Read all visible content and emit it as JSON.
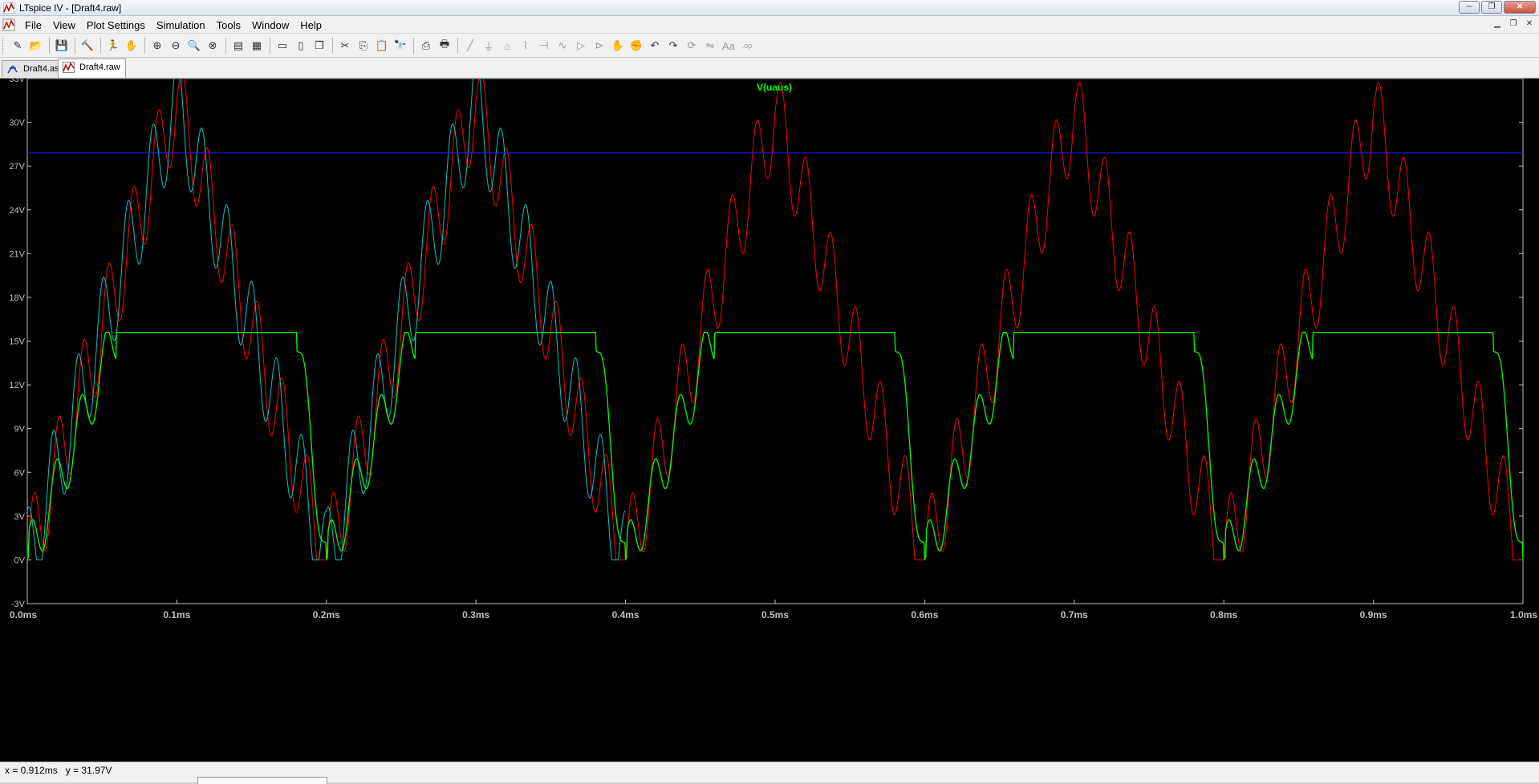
{
  "window": {
    "title": "LTspice IV - [Draft4.raw]",
    "minimize_label": "─",
    "restore_label": "❐",
    "close_label": "✕"
  },
  "menubar": {
    "items": [
      "File",
      "View",
      "Plot Settings",
      "Simulation",
      "Tools",
      "Window",
      "Help"
    ]
  },
  "toolbar": {
    "icons": [
      "new-schematic-icon",
      "open-icon",
      "sep",
      "save-icon",
      "sep",
      "control-panel-icon",
      "sep",
      "run-icon",
      "halt-icon",
      "sep",
      "zoom-in-icon",
      "zoom-out-icon",
      "zoom-area-icon",
      "zoom-fit-icon",
      "sep",
      "autorange-icon",
      "grid-icon",
      "sep",
      "tile-horizontal-icon",
      "tile-vertical-icon",
      "cascade-icon",
      "sep",
      "cut-icon",
      "copy-icon",
      "paste-icon",
      "find-icon",
      "sep",
      "print-preview-icon",
      "print-icon",
      "sep",
      "wire-icon",
      "ground-icon",
      "label-icon",
      "resistor-icon",
      "capacitor-icon",
      "inductor-icon",
      "diode-icon",
      "component-icon",
      "move-icon",
      "drag-icon",
      "undo-icon",
      "redo-icon",
      "rotate-icon",
      "mirror-icon",
      "text-icon",
      "spice-directive-icon"
    ]
  },
  "tabs": [
    {
      "label": "Draft4.asc",
      "active": false
    },
    {
      "label": "Draft4.raw",
      "active": true
    }
  ],
  "status": {
    "cursor_x": "x = 0.912ms",
    "cursor_y": "y = 31.97V"
  },
  "chart_data": {
    "type": "line",
    "title": "V(uaus)",
    "xlabel": "",
    "ylabel": "",
    "xlim": [
      0,
      1.0
    ],
    "ylim": [
      -3,
      33
    ],
    "x_ticks": [
      "0.0ms",
      "0.1ms",
      "0.2ms",
      "0.3ms",
      "0.4ms",
      "0.5ms",
      "0.6ms",
      "0.7ms",
      "0.8ms",
      "0.9ms",
      "1.0ms"
    ],
    "y_ticks": [
      "-3V",
      "0V",
      "3V",
      "6V",
      "9V",
      "12V",
      "15V",
      "18V",
      "21V",
      "24V",
      "27V",
      "30V",
      "33V"
    ],
    "grid": false,
    "colors": {
      "background": "#000000",
      "axes": "#c0c0c0",
      "title": "#00ff00",
      "red_trace": "#ff0000",
      "cyan_trace": "#00c8c8",
      "green_trace": "#00ff00",
      "blue_line": "#1a1aff"
    },
    "series": [
      {
        "name": "V(uaus)",
        "color": "#00ff00",
        "x": [
          0,
          0.02,
          0.06,
          0.18,
          0.2,
          0.22,
          0.26,
          0.38,
          0.4,
          0.42,
          0.46,
          0.58,
          0.6,
          0.62,
          0.66,
          0.78,
          0.8,
          0.82,
          0.86,
          0.98,
          1.0
        ],
        "values": [
          0,
          5,
          15.6,
          15.6,
          0,
          5,
          15.6,
          15.6,
          0,
          5,
          15.6,
          15.6,
          0,
          5,
          15.6,
          15.6,
          0,
          5,
          15.6,
          15.6,
          0
        ]
      },
      {
        "color": "#ff0000",
        "x": [
          0,
          0.1,
          0.2,
          0.3,
          0.4,
          0.5,
          0.6,
          0.7,
          0.8,
          0.9,
          1.0
        ],
        "values": [
          0,
          31.5,
          0,
          31.5,
          0,
          30.7,
          0,
          30.7,
          0,
          30.7,
          0
        ]
      },
      {
        "color": "#00c8c8",
        "x": [
          0,
          0.1,
          0.2,
          0.3,
          0.4
        ],
        "values": [
          0,
          31.5,
          0,
          31.5,
          0
        ]
      },
      {
        "color": "#1a1aff",
        "x": [
          0,
          1.0
        ],
        "values": [
          27.9,
          27.9
        ]
      }
    ]
  }
}
